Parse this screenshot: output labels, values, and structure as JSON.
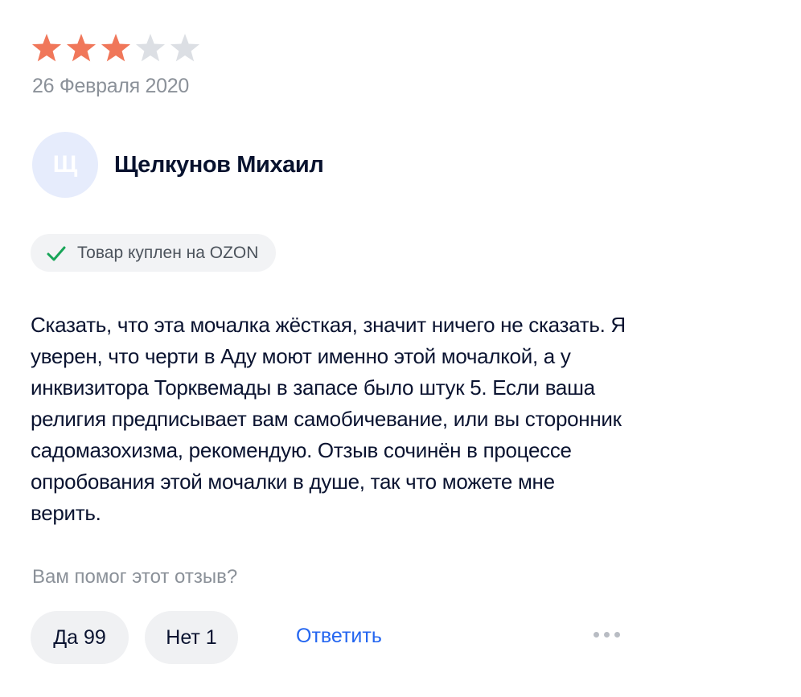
{
  "review": {
    "rating": 3,
    "rating_max": 5,
    "star_filled_color": "#f0775a",
    "star_empty_color": "#dcdfe4",
    "date": "26 Февраля 2020",
    "author": {
      "avatar_initial": "Щ",
      "name": "Щелкунов Михаил"
    },
    "badge": {
      "icon": "check-icon",
      "label": "Товар куплен на OZON"
    },
    "text": "Сказать, что эта мочалка жёсткая, значит ничего не сказать. Я уверен, что черти в Аду моют именно этой мочалкой, а у инквизитора Торквемады в запасе было штук 5. Если ваша религия предписывает вам самобичевание, или вы сторонник садомазохизма, рекомендую. Отзыв сочинён в процессе опробования этой мочалки в душе, так что можете мне верить.",
    "helpful_prompt": "Вам помог этот отзыв?",
    "votes": {
      "yes_label": "Да 99",
      "no_label": "Нет 1"
    },
    "reply_label": "Ответить",
    "more_icon": "more-dots-icon"
  }
}
